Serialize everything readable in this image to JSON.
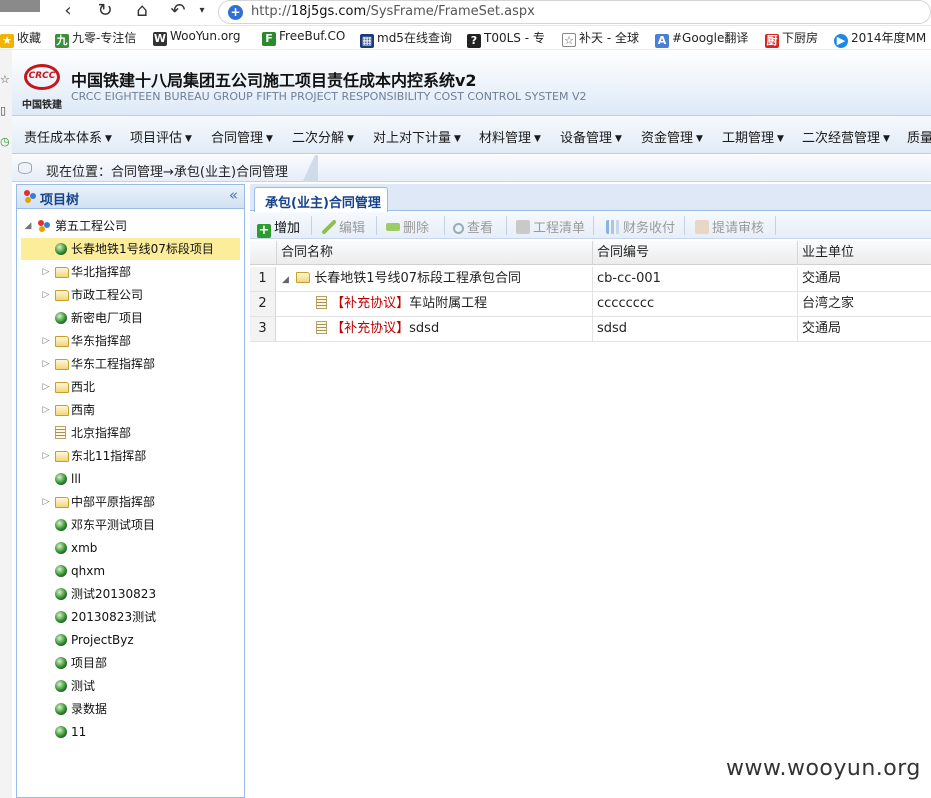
{
  "browser": {
    "url_prefix": "http://",
    "url_host": "18j5gs.com",
    "url_path": "/SysFrame/FrameSet.aspx",
    "bookmarks": [
      "收藏",
      "九零-专注信",
      "WooYun.org",
      "FreeBuf.CO",
      "md5在线查询",
      "T00LS - 专",
      "补天 - 全球",
      "#Google翻译",
      "下厨房",
      "2014年度MM"
    ]
  },
  "header": {
    "logo_text": "CRCC",
    "logo_label": "中国铁建",
    "title": "中国铁建十八局集团五公司施工项目责任成本内控系统v2",
    "subtitle": "CRCC EIGHTEEN BUREAU GROUP FIFTH PROJECT RESPONSIBILITY COST CONTROL SYSTEM V2"
  },
  "nav": [
    "责任成本体系",
    "项目评估",
    "合同管理",
    "二次分解",
    "对上对下计量",
    "材料管理",
    "设备管理",
    "资金管理",
    "工期管理",
    "二次经营管理",
    "质量"
  ],
  "breadcrumb": "现在位置：合同管理→承包(业主)合同管理",
  "tree": {
    "title": "项目树",
    "collapse": "«",
    "root": "第五工程公司",
    "items": [
      {
        "label": "长春地铁1号线07标段项目",
        "icon": "globe-icon"
      },
      {
        "label": "华北指挥部",
        "icon": "folder-icon"
      },
      {
        "label": "市政工程公司",
        "icon": "folder-icon"
      },
      {
        "label": "新密电厂项目",
        "icon": "globe-icon"
      },
      {
        "label": "华东指挥部",
        "icon": "folder-icon"
      },
      {
        "label": "华东工程指挥部",
        "icon": "folder-icon"
      },
      {
        "label": "西北",
        "icon": "folder-icon"
      },
      {
        "label": "西南",
        "icon": "folder-icon"
      },
      {
        "label": "北京指挥部",
        "icon": "document-icon"
      },
      {
        "label": "东北11指挥部",
        "icon": "folder-icon"
      },
      {
        "label": "lll",
        "icon": "globe-icon"
      },
      {
        "label": "中部平原指挥部",
        "icon": "folder-icon"
      },
      {
        "label": "邓东平测试项目",
        "icon": "globe-icon"
      },
      {
        "label": "xmb",
        "icon": "globe-icon"
      },
      {
        "label": "qhxm",
        "icon": "globe-icon"
      },
      {
        "label": "测试20130823",
        "icon": "globe-icon"
      },
      {
        "label": "20130823测试",
        "icon": "globe-icon"
      },
      {
        "label": "ProjectByz",
        "icon": "globe-icon"
      },
      {
        "label": "项目部",
        "icon": "globe-icon"
      },
      {
        "label": "测试",
        "icon": "globe-icon"
      },
      {
        "label": "录数据",
        "icon": "globe-icon"
      },
      {
        "label": "11",
        "icon": "globe-icon"
      }
    ]
  },
  "main": {
    "tab": "承包(业主)合同管理",
    "toolbar": [
      "增加",
      "编辑",
      "删除",
      "查看",
      "工程清单",
      "财务收付",
      "提请审核"
    ],
    "columns": [
      "合同名称",
      "合同编号",
      "业主单位"
    ],
    "rows": [
      {
        "num": "1",
        "tag": "",
        "name": "长春地铁1号线07标段工程承包合同",
        "code": "cb-cc-001",
        "owner": "交通局"
      },
      {
        "num": "2",
        "tag": "【补充协议】",
        "name": "车站附属工程",
        "code": "cccccccc",
        "owner": "台湾之家"
      },
      {
        "num": "3",
        "tag": "【补充协议】",
        "name": "sdsd",
        "code": "sdsd",
        "owner": "交通局"
      }
    ]
  },
  "watermark": "www.wooyun.org"
}
